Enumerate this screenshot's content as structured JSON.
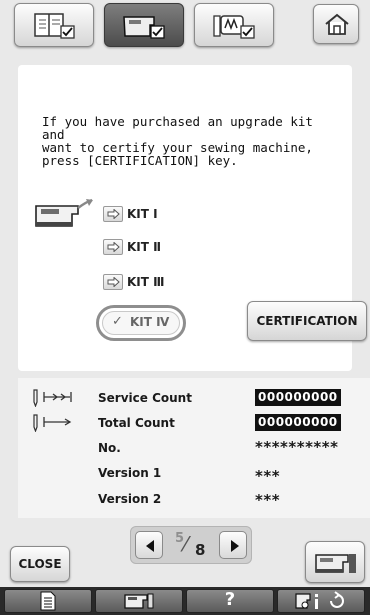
{
  "top_tabs": [
    {
      "icon": "settings-page-icon",
      "selected": false
    },
    {
      "icon": "machine-settings-icon",
      "selected": true
    },
    {
      "icon": "embroidery-settings-icon",
      "selected": false
    }
  ],
  "home_icon": "home-icon",
  "instruction_text": "If you have purchased an upgrade kit and\nwant to certify your sewing machine,\npress [CERTIFICATION] key.",
  "kits": [
    {
      "label": "KIT Ⅰ",
      "certified": false
    },
    {
      "label": "KIT Ⅱ",
      "certified": false
    },
    {
      "label": "KIT Ⅲ",
      "certified": false
    },
    {
      "label": "KIT Ⅳ",
      "certified": true
    }
  ],
  "check_mark": "✓",
  "certification_label": "CERTIFICATION",
  "info": {
    "service_count_label": "Service Count",
    "service_count": "000000000",
    "total_count_label": "Total Count",
    "total_count": "000000000",
    "no_label": "No.",
    "no_value": "**********",
    "version1_label": "Version 1",
    "version1_value": "***",
    "version2_label": "Version 2",
    "version2_value": "***"
  },
  "pager": {
    "current": "5",
    "total": "8"
  },
  "close_label": "CLOSE",
  "bottom_help": "?",
  "accent": "#8e8e8e"
}
